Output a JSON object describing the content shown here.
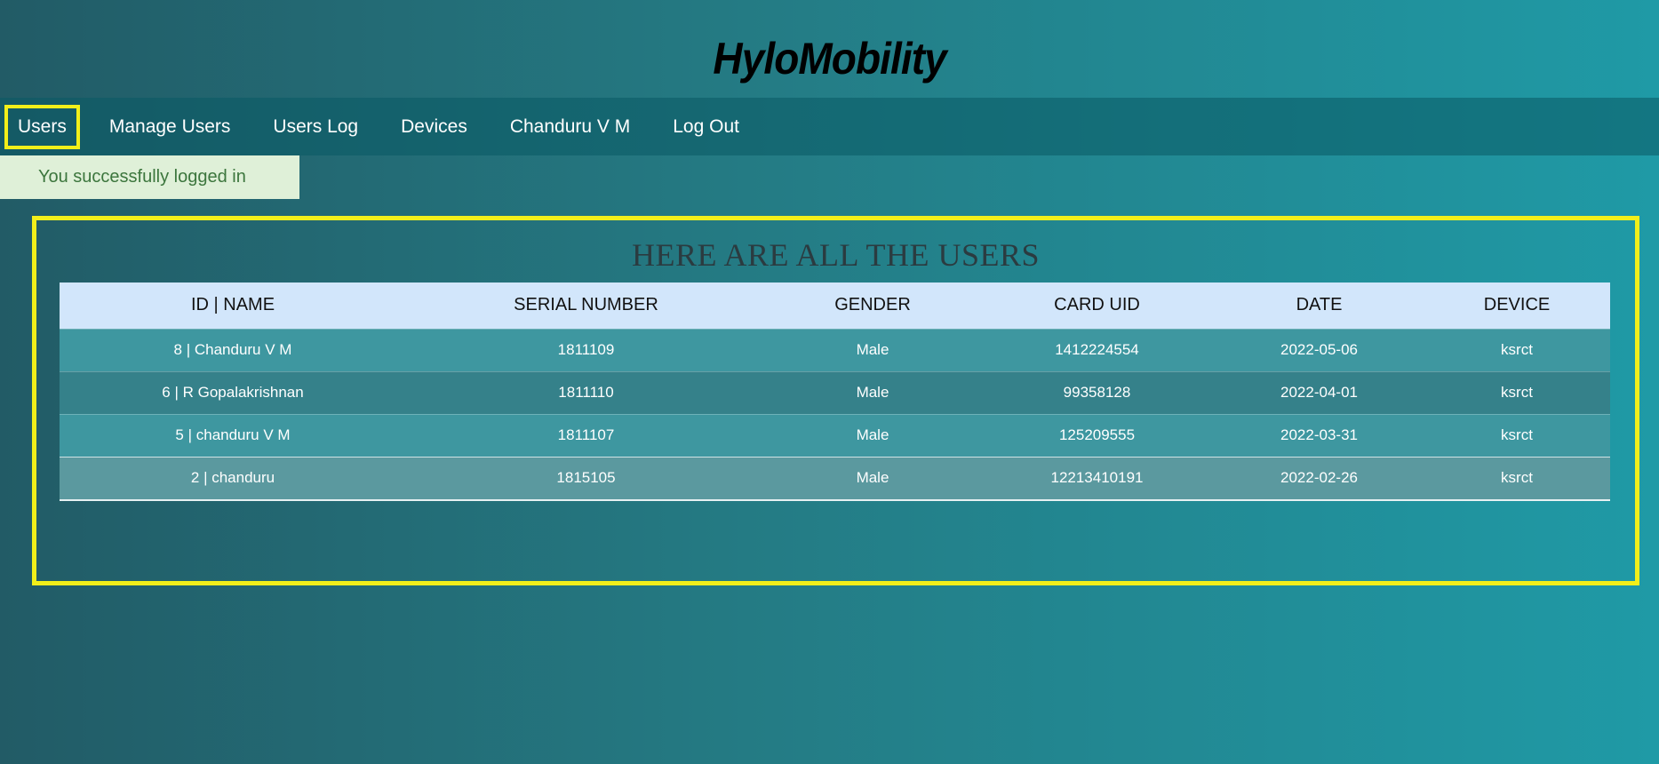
{
  "app": {
    "brand": "HyloMobility"
  },
  "nav": {
    "items": [
      {
        "label": "Users",
        "active": true
      },
      {
        "label": "Manage Users"
      },
      {
        "label": "Users Log"
      },
      {
        "label": "Devices"
      },
      {
        "label": "Chandur​u V M"
      },
      {
        "label": "Log Out"
      }
    ]
  },
  "flash": {
    "message": "You successfully logged in"
  },
  "users_panel": {
    "title": "HERE ARE ALL THE USERS",
    "columns": [
      "ID | NAME",
      "SERIAL NUMBER",
      "GENDER",
      "CARD UID",
      "DATE",
      "DEVICE"
    ],
    "rows": [
      [
        "8 | Chanduru V M",
        "1811109",
        "Male",
        "1412224554",
        "2022-05-06",
        "ksrct"
      ],
      [
        "6 | R Gopalakrishnan",
        "1811110",
        "Male",
        "99358128",
        "2022-04-01",
        "ksrct"
      ],
      [
        "5 | chanduru V M",
        "1811107",
        "Male",
        "125209555",
        "2022-03-31",
        "ksrct"
      ],
      [
        "2 | chanduru",
        "1815105",
        "Male",
        "12213410191",
        "2022-02-26",
        "ksrct"
      ]
    ]
  },
  "colors": {
    "highlight": "#f2ef1a",
    "header_row": "#d2e6fb",
    "flash_bg": "#dff0d8",
    "flash_text": "#3c763d"
  }
}
